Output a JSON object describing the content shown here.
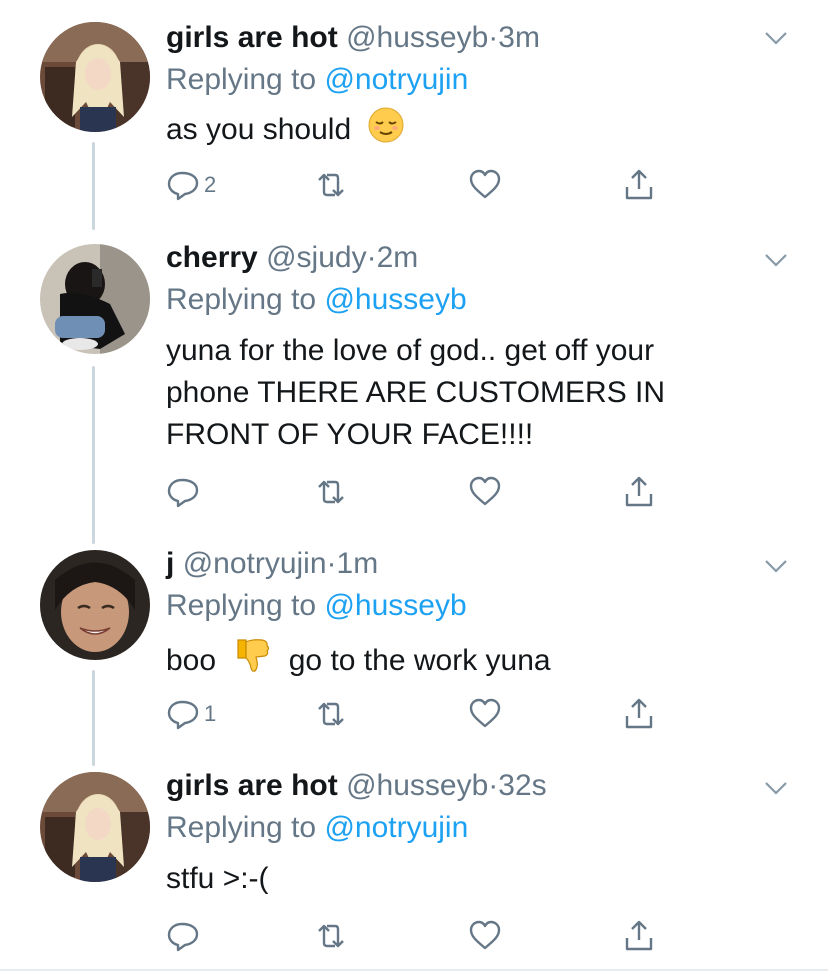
{
  "tweets": [
    {
      "display_name": "girls are hot",
      "handle": "@husseyb",
      "time": "3m",
      "reply_prefix": "Replying to",
      "reply_to": "@notryujin",
      "text": "as you should",
      "emoji": "relieved-face",
      "reply_count": "2",
      "retweet_count": "",
      "like_count": ""
    },
    {
      "display_name": "cherry",
      "handle": "@sjudy",
      "time": "2m",
      "reply_prefix": "Replying to",
      "reply_to": "@husseyb",
      "text_lines": [
        "yuna for the love of god.. get off your",
        "phone THERE ARE CUSTOMERS IN",
        "FRONT OF YOUR FACE!!!!"
      ],
      "reply_count": "",
      "retweet_count": "",
      "like_count": ""
    },
    {
      "display_name": "j",
      "handle": "@notryujin",
      "time": "1m",
      "reply_prefix": "Replying to",
      "reply_to": "@husseyb",
      "text_before": "boo",
      "emoji": "thumbs-down",
      "text_after": "go to the work yuna",
      "reply_count": "1",
      "retweet_count": "",
      "like_count": ""
    },
    {
      "display_name": "girls are hot",
      "handle": "@husseyb",
      "time": "32s",
      "reply_prefix": "Replying to",
      "reply_to": "@notryujin",
      "text": "stfu >:-(",
      "reply_count": "",
      "retweet_count": "",
      "like_count": ""
    }
  ],
  "separator": "·",
  "colors": {
    "text": "#14171a",
    "secondary": "#657786",
    "link": "#1da1f2",
    "thread_line": "#ccd6dd"
  }
}
